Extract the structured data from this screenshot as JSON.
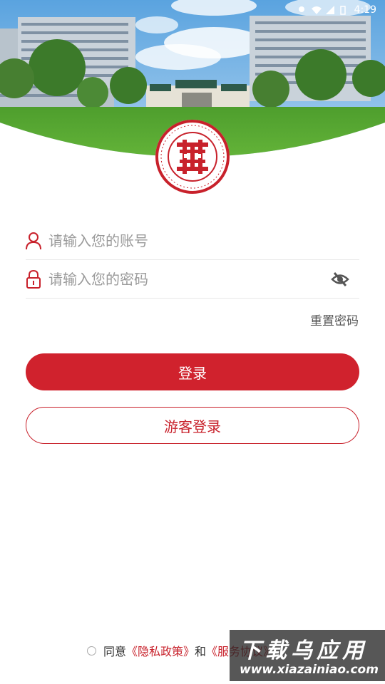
{
  "status_bar": {
    "time": "4:19"
  },
  "logo": {
    "brand_color": "#c8212b",
    "ring_text": "GUANGZHOU HUA XIA VOCATIONAL COLLEGE"
  },
  "form": {
    "account_placeholder": "请输入您的账号",
    "password_placeholder": "请输入您的密码",
    "account_icon": "user-icon",
    "password_icon": "lock-icon",
    "visibility_icon": "eye-off-icon",
    "reset_password": "重置密码"
  },
  "buttons": {
    "login": "登录",
    "guest_login": "游客登录"
  },
  "agreement": {
    "prefix": "同意",
    "privacy": "《隐私政策》",
    "and": "和",
    "service": "《服务协议》"
  },
  "watermark": {
    "title": "下载乌应用",
    "url": "www.xiazainiao.com"
  },
  "colors": {
    "accent": "#d0222d",
    "text": "#333333",
    "placeholder": "#9a9a9a"
  }
}
